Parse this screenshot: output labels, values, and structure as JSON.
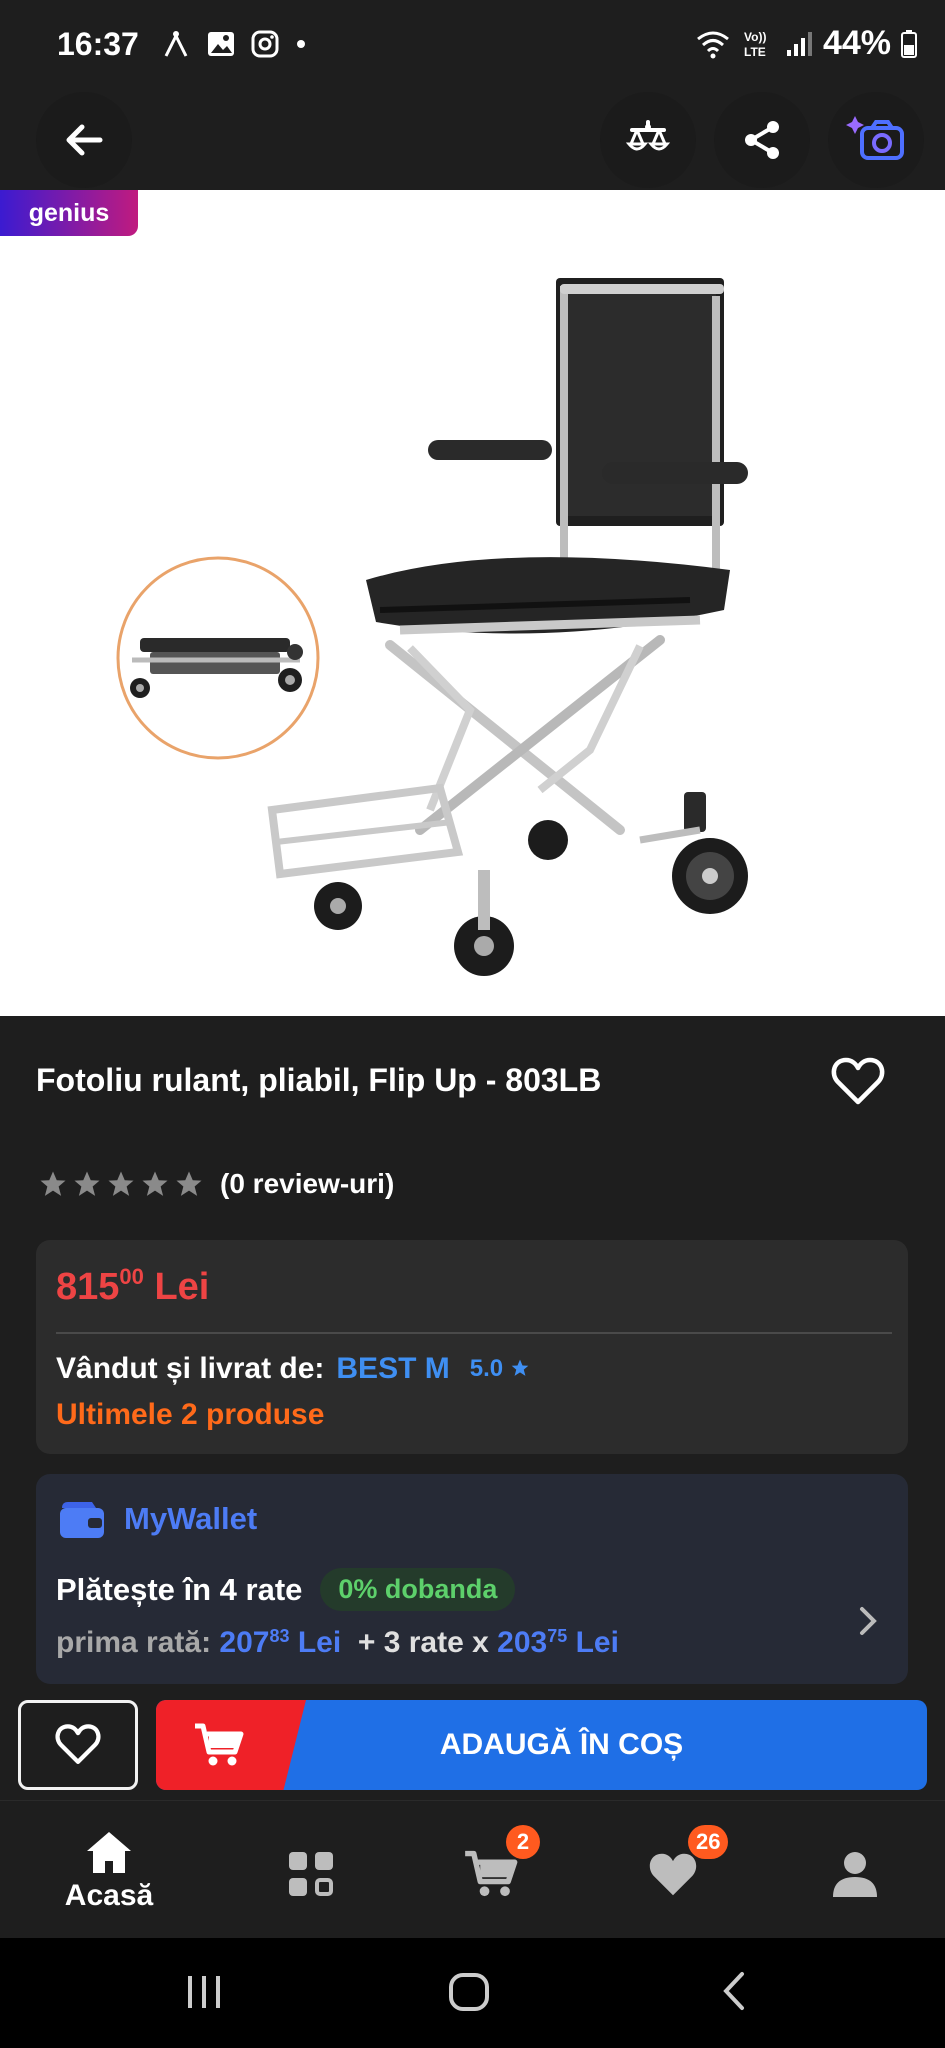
{
  "status_bar": {
    "time": "16:37",
    "battery": "44%",
    "icons": [
      "wifi-calling-icon",
      "gallery-icon",
      "instagram-icon",
      "dot-icon",
      "wifi-icon",
      "volte-icon",
      "signal-icon",
      "battery-icon"
    ]
  },
  "app_bar": {
    "icons": [
      "back-arrow-icon",
      "compare-scale-icon",
      "share-icon",
      "visual-search-camera-icon"
    ]
  },
  "badge": {
    "genius": "genius"
  },
  "product": {
    "title": "Fotoliu rulant, pliabil, Flip Up - 803LB",
    "reviews": "(0 review-uri)",
    "stars_filled": 0,
    "stars_total": 5
  },
  "price": {
    "integer": "815",
    "decimals": "00",
    "currency": "Lei",
    "seller_label": "Vândut și livrat de:",
    "seller_name": "BEST M",
    "seller_rating": "5.0",
    "stock": "Ultimele 2 produse"
  },
  "wallet": {
    "title": "MyWallet",
    "installments": "Plătește în 4 rate",
    "interest": "0% dobanda",
    "first_rate_label": "prima rată:",
    "first_rate_int": "207",
    "first_rate_dec": "83",
    "first_rate_currency": "Lei",
    "rest_label": "+ 3 rate x",
    "rest_int": "203",
    "rest_dec": "75",
    "rest_currency": "Lei"
  },
  "actions": {
    "add_to_cart": "ADAUGĂ ÎN COȘ"
  },
  "bottom_nav": {
    "home": "Acasă",
    "cart_badge": "2",
    "favorites_badge": "26"
  },
  "colors": {
    "price_red": "#ee4444",
    "accent_blue": "#1f6fe6",
    "stock_orange": "#ff6a1a",
    "badge_orange": "#ff5a1f",
    "interest_green": "#5dd06b"
  }
}
